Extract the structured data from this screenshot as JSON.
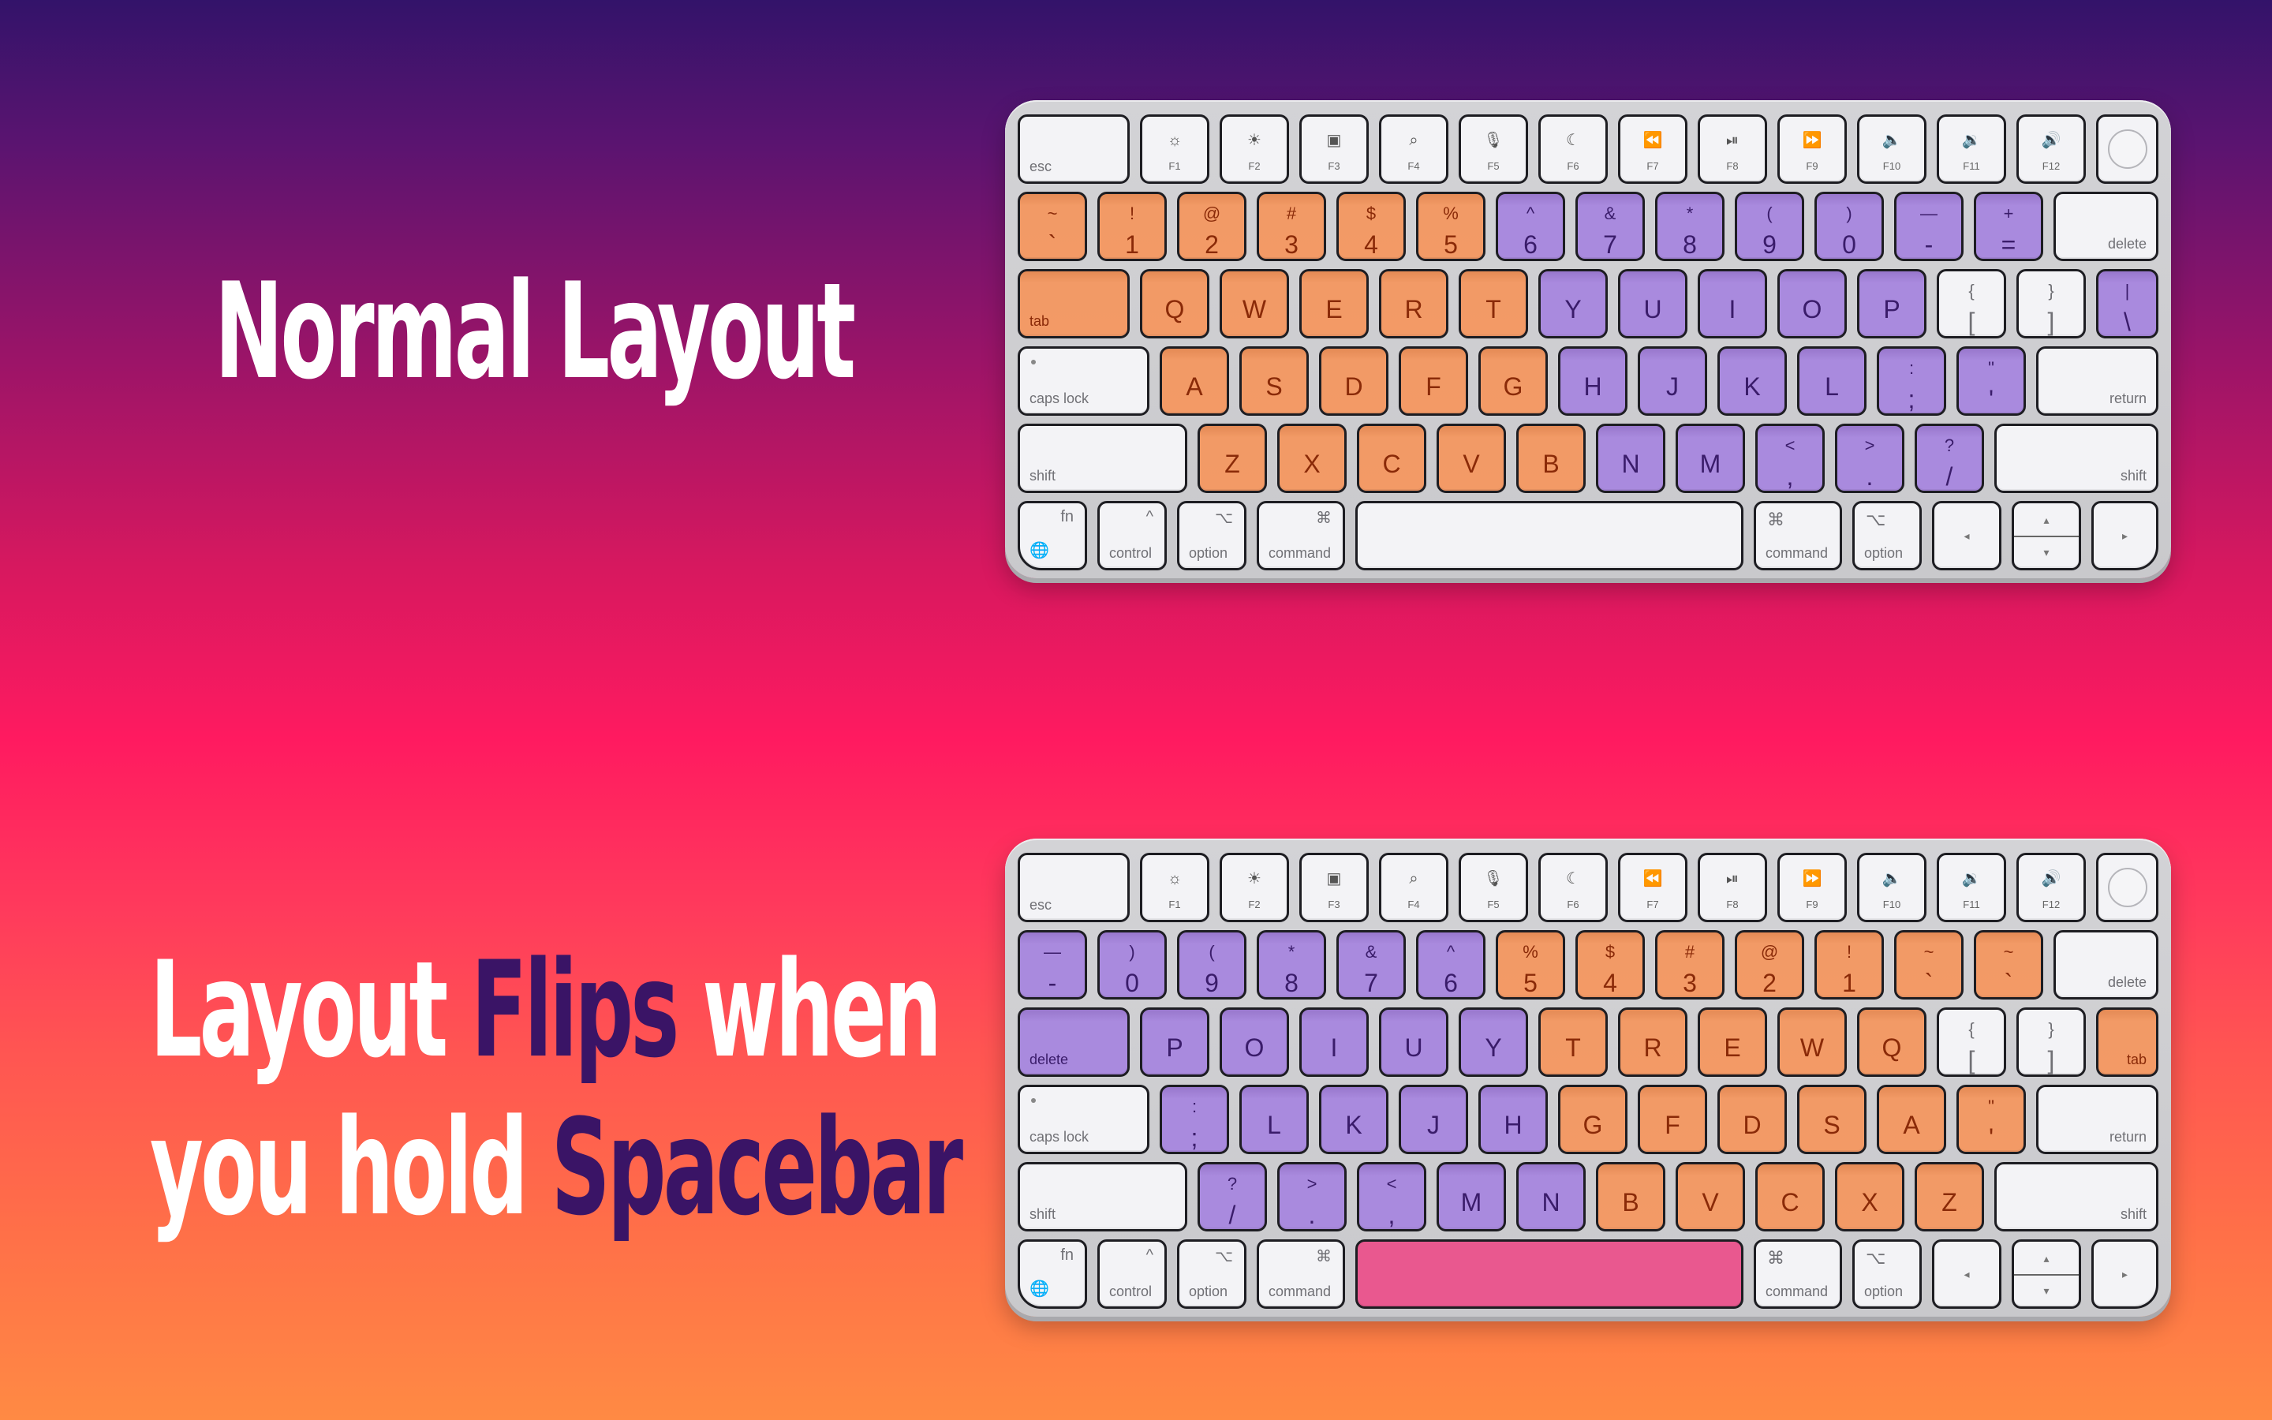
{
  "headlines": {
    "normal": "Normal Layout",
    "flipped": {
      "line1": [
        "Layout ",
        "Flips",
        " when"
      ],
      "line2": [
        "you hold ",
        "Spacebar"
      ]
    }
  },
  "colors": {
    "left_hand": "#f39a66",
    "right_hand": "#a98ade",
    "spacebar_active": "#e9588f",
    "accent_text": "#3a1466"
  },
  "function_row": [
    {
      "label": "esc",
      "icon": "",
      "name": "esc"
    },
    {
      "label": "F1",
      "icon": "☼",
      "name": "brightness-down-icon"
    },
    {
      "label": "F2",
      "icon": "☀",
      "name": "brightness-up-icon"
    },
    {
      "label": "F3",
      "icon": "▣",
      "name": "mission-control-icon"
    },
    {
      "label": "F4",
      "icon": "⌕",
      "name": "search-icon"
    },
    {
      "label": "F5",
      "icon": "🎙",
      "name": "microphone-icon"
    },
    {
      "label": "F6",
      "icon": "☾",
      "name": "moon-icon"
    },
    {
      "label": "F7",
      "icon": "⏪",
      "name": "rewind-icon"
    },
    {
      "label": "F8",
      "icon": "⏯",
      "name": "play-pause-icon"
    },
    {
      "label": "F9",
      "icon": "⏩",
      "name": "fast-forward-icon"
    },
    {
      "label": "F10",
      "icon": "🔈",
      "name": "mute-icon"
    },
    {
      "label": "F11",
      "icon": "🔉",
      "name": "volume-down-icon"
    },
    {
      "label": "F12",
      "icon": "🔊",
      "name": "volume-up-icon"
    }
  ],
  "modifiers": {
    "delete": "delete",
    "tab": "tab",
    "caps_lock": "caps lock",
    "return": "return",
    "shift": "shift",
    "fn": "fn",
    "control": "control",
    "option": "option",
    "command": "command",
    "control_symbol": "^",
    "option_symbol": "⌥",
    "command_symbol": "⌘",
    "left_arrow": "◂",
    "right_arrow": "▸",
    "up_arrow": "▴",
    "down_arrow": "▾",
    "globe": "🌐"
  },
  "keyboards": [
    {
      "name": "normal",
      "spacebar_color": "white",
      "number_row": [
        {
          "t": "~",
          "m": "`",
          "c": "orange"
        },
        {
          "t": "!",
          "m": "1",
          "c": "orange"
        },
        {
          "t": "@",
          "m": "2",
          "c": "orange"
        },
        {
          "t": "#",
          "m": "3",
          "c": "orange"
        },
        {
          "t": "$",
          "m": "4",
          "c": "orange"
        },
        {
          "t": "%",
          "m": "5",
          "c": "orange"
        },
        {
          "t": "^",
          "m": "6",
          "c": "purple"
        },
        {
          "t": "&",
          "m": "7",
          "c": "purple"
        },
        {
          "t": "*",
          "m": "8",
          "c": "purple"
        },
        {
          "t": "(",
          "m": "9",
          "c": "purple"
        },
        {
          "t": ")",
          "m": "0",
          "c": "purple"
        },
        {
          "t": "—",
          "m": "-",
          "c": "purple"
        },
        {
          "t": "+",
          "m": "=",
          "c": "purple"
        }
      ],
      "number_row_end": {
        "label": "delete",
        "c": "white",
        "pos": "br"
      },
      "qwerty_start": {
        "label": "tab",
        "c": "orange",
        "pos": "bl"
      },
      "qwerty_row": [
        {
          "m": "Q",
          "c": "orange"
        },
        {
          "m": "W",
          "c": "orange"
        },
        {
          "m": "E",
          "c": "orange"
        },
        {
          "m": "R",
          "c": "orange"
        },
        {
          "m": "T",
          "c": "orange"
        },
        {
          "m": "Y",
          "c": "purple"
        },
        {
          "m": "U",
          "c": "purple"
        },
        {
          "m": "I",
          "c": "purple"
        },
        {
          "m": "O",
          "c": "purple"
        },
        {
          "m": "P",
          "c": "purple"
        },
        {
          "t": "{",
          "m": "[",
          "c": "white"
        },
        {
          "t": "}",
          "m": "]",
          "c": "white"
        },
        {
          "t": "|",
          "m": "\\",
          "c": "purple"
        }
      ],
      "home_row": [
        {
          "m": "A",
          "c": "orange"
        },
        {
          "m": "S",
          "c": "orange"
        },
        {
          "m": "D",
          "c": "orange"
        },
        {
          "m": "F",
          "c": "orange",
          "bump": true
        },
        {
          "m": "G",
          "c": "orange"
        },
        {
          "m": "H",
          "c": "purple"
        },
        {
          "m": "J",
          "c": "purple",
          "bump": true
        },
        {
          "m": "K",
          "c": "purple"
        },
        {
          "m": "L",
          "c": "purple"
        },
        {
          "t": ":",
          "m": ";",
          "c": "purple"
        },
        {
          "t": "\"",
          "m": "'",
          "c": "purple"
        }
      ],
      "bottom_row": [
        {
          "m": "Z",
          "c": "orange"
        },
        {
          "m": "X",
          "c": "orange"
        },
        {
          "m": "C",
          "c": "orange"
        },
        {
          "m": "V",
          "c": "orange"
        },
        {
          "m": "B",
          "c": "orange"
        },
        {
          "m": "N",
          "c": "purple"
        },
        {
          "m": "M",
          "c": "purple"
        },
        {
          "t": "<",
          "m": ",",
          "c": "purple"
        },
        {
          "t": ">",
          "m": ".",
          "c": "purple"
        },
        {
          "t": "?",
          "m": "/",
          "c": "purple"
        }
      ]
    },
    {
      "name": "flipped",
      "spacebar_color": "pink",
      "number_row": [
        {
          "t": "—",
          "m": "-",
          "c": "purple"
        },
        {
          "t": ")",
          "m": "0",
          "c": "purple"
        },
        {
          "t": "(",
          "m": "9",
          "c": "purple"
        },
        {
          "t": "*",
          "m": "8",
          "c": "purple"
        },
        {
          "t": "&",
          "m": "7",
          "c": "purple"
        },
        {
          "t": "^",
          "m": "6",
          "c": "purple"
        },
        {
          "t": "%",
          "m": "5",
          "c": "orange"
        },
        {
          "t": "$",
          "m": "4",
          "c": "orange"
        },
        {
          "t": "#",
          "m": "3",
          "c": "orange"
        },
        {
          "t": "@",
          "m": "2",
          "c": "orange"
        },
        {
          "t": "!",
          "m": "1",
          "c": "orange"
        },
        {
          "t": "~",
          "m": "`",
          "c": "orange"
        },
        {
          "t": "~",
          "m": "`",
          "c": "orange"
        }
      ],
      "number_row_end": {
        "label": "delete",
        "c": "white",
        "pos": "br"
      },
      "qwerty_start": {
        "label": "delete",
        "c": "purple",
        "pos": "bl"
      },
      "qwerty_row": [
        {
          "m": "P",
          "c": "purple"
        },
        {
          "m": "O",
          "c": "purple"
        },
        {
          "m": "I",
          "c": "purple"
        },
        {
          "m": "U",
          "c": "purple"
        },
        {
          "m": "Y",
          "c": "purple"
        },
        {
          "m": "T",
          "c": "orange"
        },
        {
          "m": "R",
          "c": "orange"
        },
        {
          "m": "E",
          "c": "orange"
        },
        {
          "m": "W",
          "c": "orange"
        },
        {
          "m": "Q",
          "c": "orange"
        },
        {
          "t": "{",
          "m": "[",
          "c": "white"
        },
        {
          "t": "}",
          "m": "]",
          "c": "white"
        },
        {
          "label": "tab",
          "c": "orange",
          "pos": "br"
        }
      ],
      "home_row": [
        {
          "t": ":",
          "m": ";",
          "c": "purple"
        },
        {
          "m": "L",
          "c": "purple"
        },
        {
          "m": "K",
          "c": "purple"
        },
        {
          "m": "J",
          "c": "purple",
          "bump": true
        },
        {
          "m": "H",
          "c": "purple"
        },
        {
          "m": "G",
          "c": "orange"
        },
        {
          "m": "F",
          "c": "orange",
          "bump": true
        },
        {
          "m": "D",
          "c": "orange"
        },
        {
          "m": "S",
          "c": "orange"
        },
        {
          "m": "A",
          "c": "orange"
        },
        {
          "t": "\"",
          "m": "'",
          "c": "orange"
        }
      ],
      "bottom_row": [
        {
          "t": "?",
          "m": "/",
          "c": "purple"
        },
        {
          "t": ">",
          "m": ".",
          "c": "purple"
        },
        {
          "t": "<",
          "m": ",",
          "c": "purple"
        },
        {
          "m": "M",
          "c": "purple"
        },
        {
          "m": "N",
          "c": "purple"
        },
        {
          "m": "B",
          "c": "orange"
        },
        {
          "m": "V",
          "c": "orange"
        },
        {
          "m": "C",
          "c": "orange"
        },
        {
          "m": "X",
          "c": "orange"
        },
        {
          "m": "Z",
          "c": "orange"
        }
      ]
    }
  ]
}
